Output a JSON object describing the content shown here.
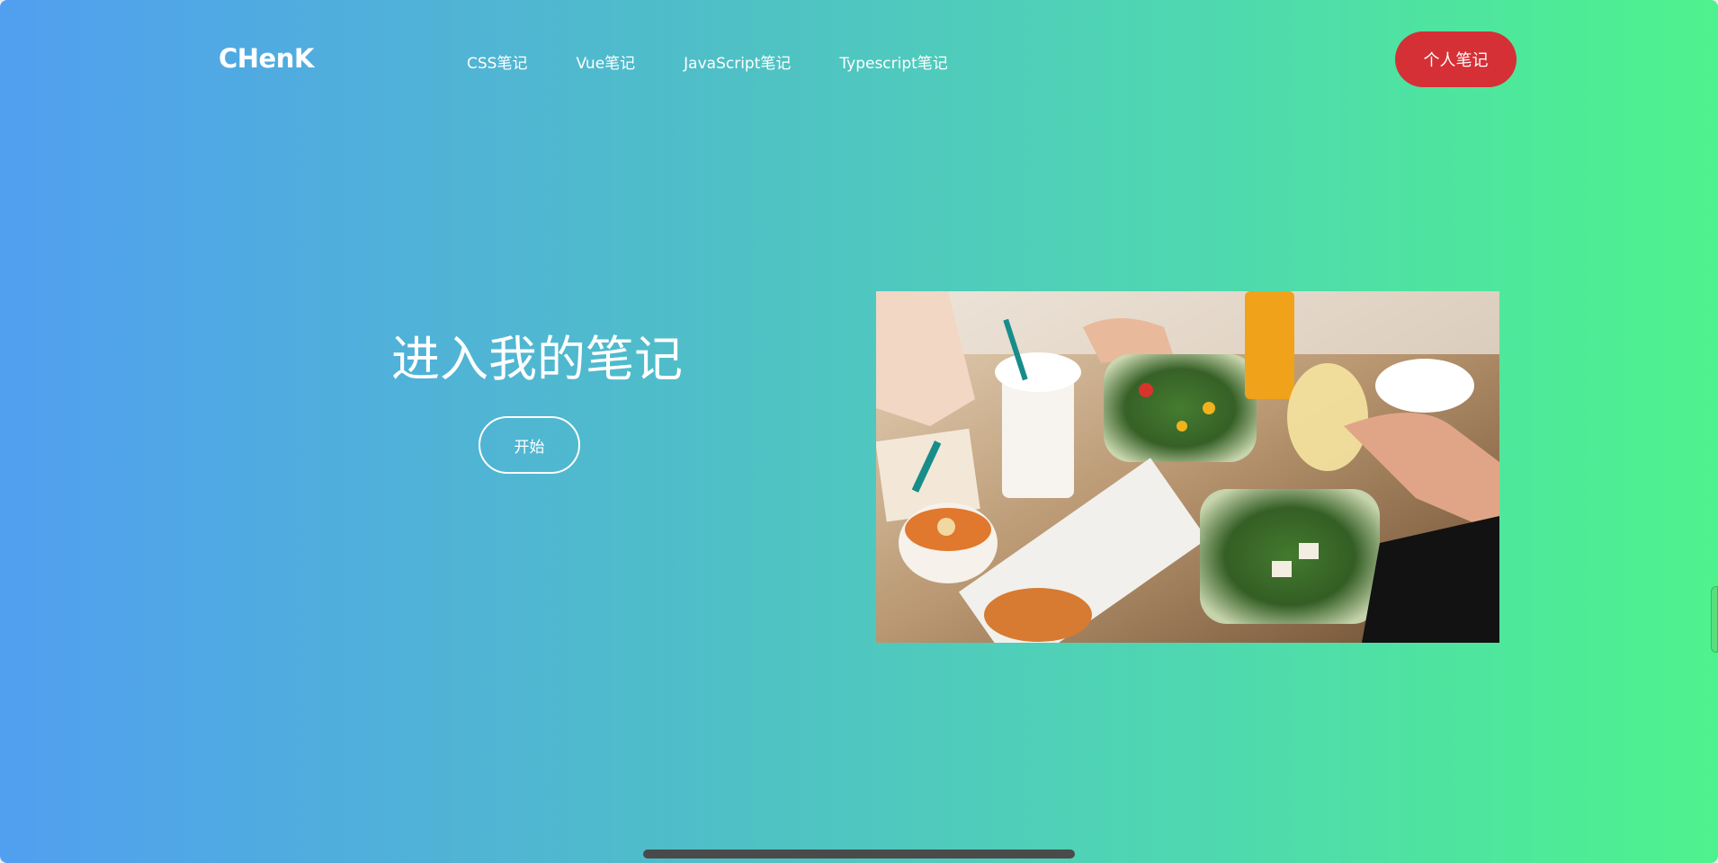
{
  "brand": {
    "logo": "CHenK"
  },
  "nav": {
    "links": [
      {
        "label": "CSS笔记"
      },
      {
        "label": "Vue笔记"
      },
      {
        "label": "JavaScript笔记"
      },
      {
        "label": "Typescript笔记"
      }
    ],
    "cta_label": "个人笔记"
  },
  "hero": {
    "title": "进入我的笔记",
    "start_label": "开始",
    "image_icon": "food-photo"
  },
  "colors": {
    "gradient_start": "#519ff0",
    "gradient_end": "#4ef28d",
    "cta_background": "#d53036",
    "text": "#ffffff"
  }
}
